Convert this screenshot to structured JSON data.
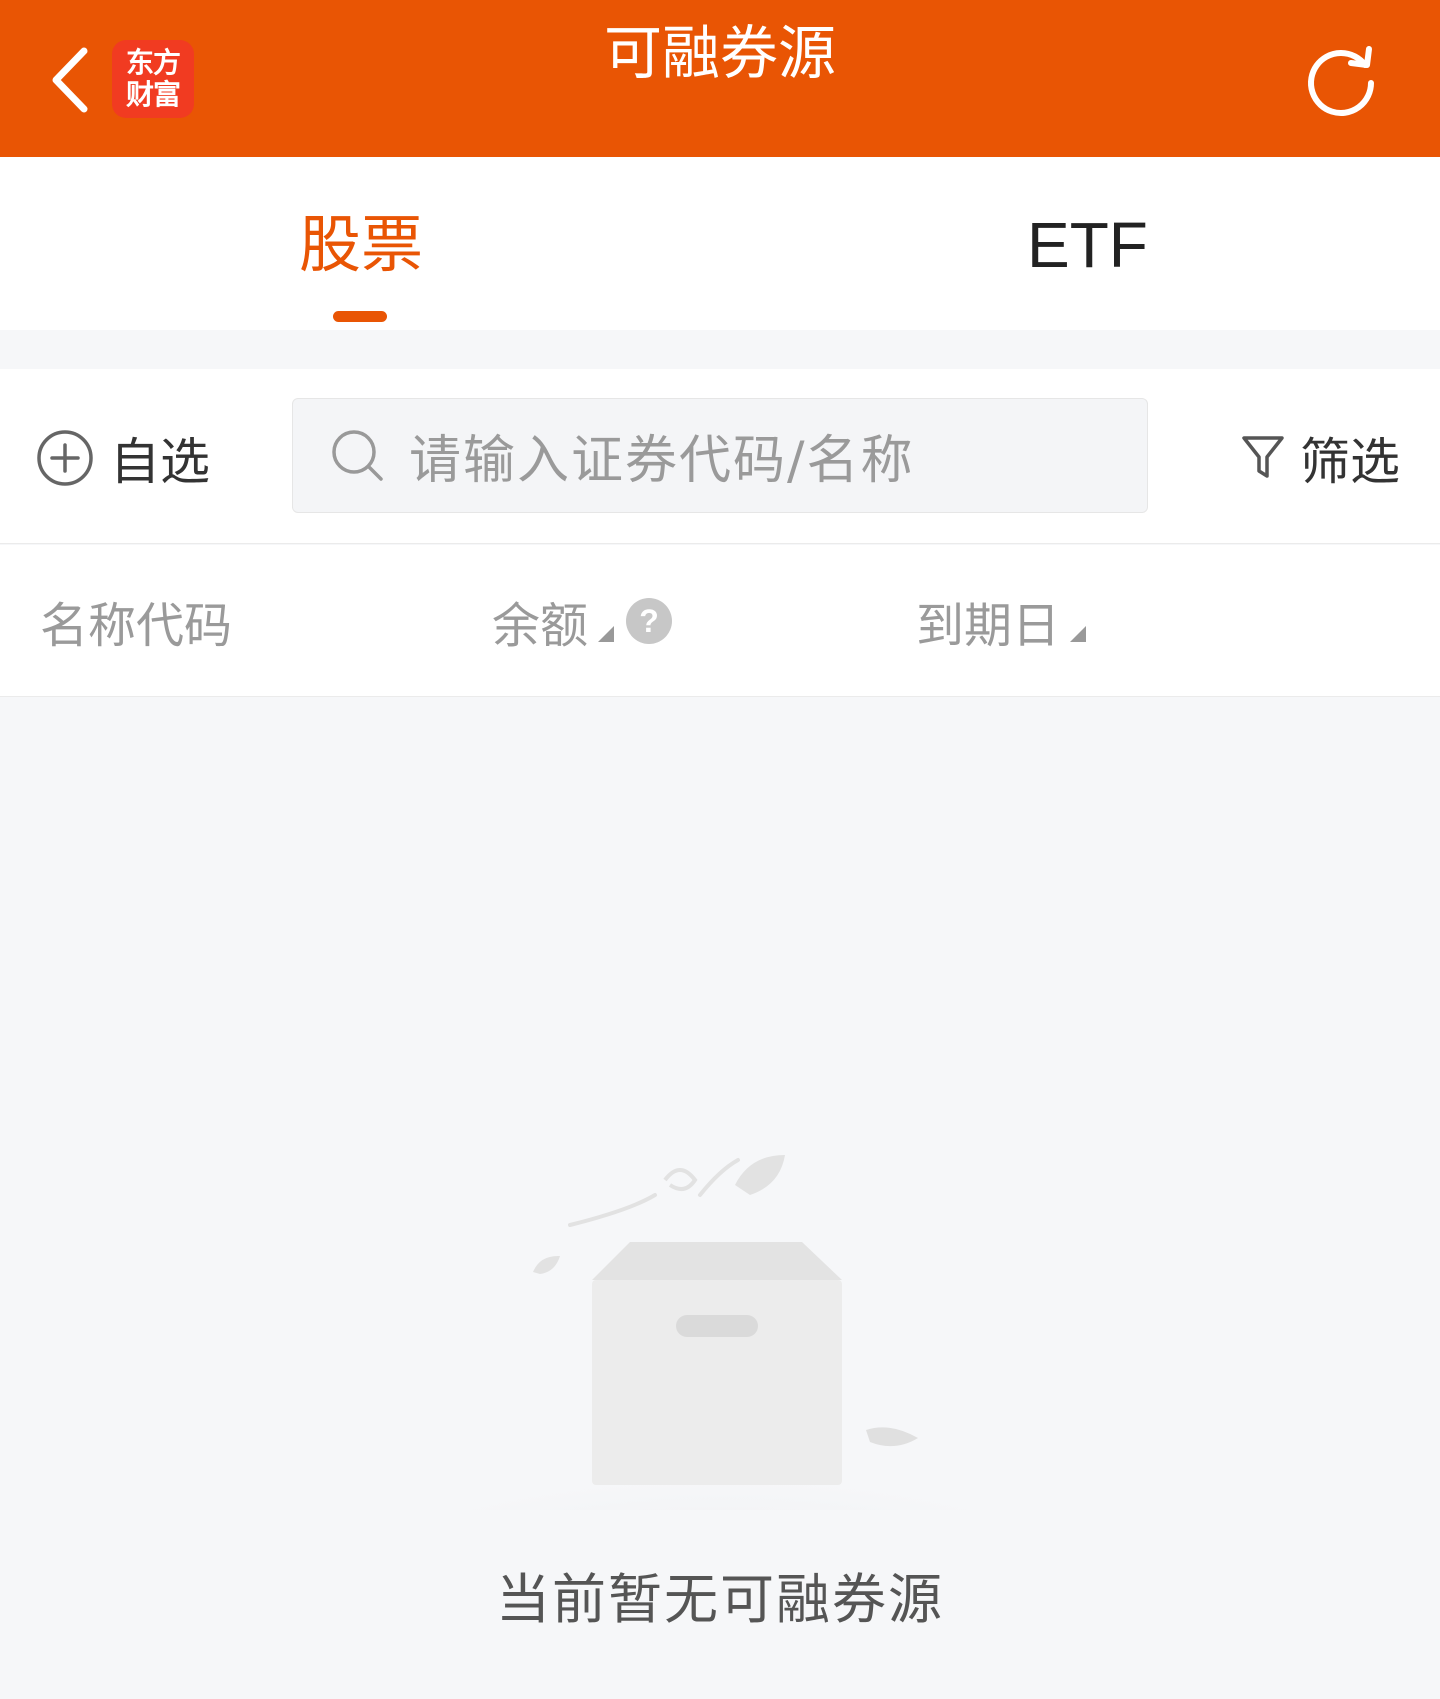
{
  "header": {
    "title": "可融券源",
    "logo_line1": "东方",
    "logo_line2": "财富",
    "background": "#e95504"
  },
  "tabs": [
    {
      "label": "股票",
      "active": true
    },
    {
      "label": "ETF",
      "active": false
    }
  ],
  "toolbar": {
    "add_favorite_label": "自选",
    "search_placeholder": "请输入证券代码/名称",
    "filter_label": "筛选"
  },
  "columns": {
    "name": "名称代码",
    "balance": "余额",
    "expiry": "到期日",
    "help_glyph": "?"
  },
  "empty_state": {
    "message": "当前暂无可融券源"
  },
  "colors": {
    "accent": "#e95504",
    "logo_red": "#f13b21"
  }
}
